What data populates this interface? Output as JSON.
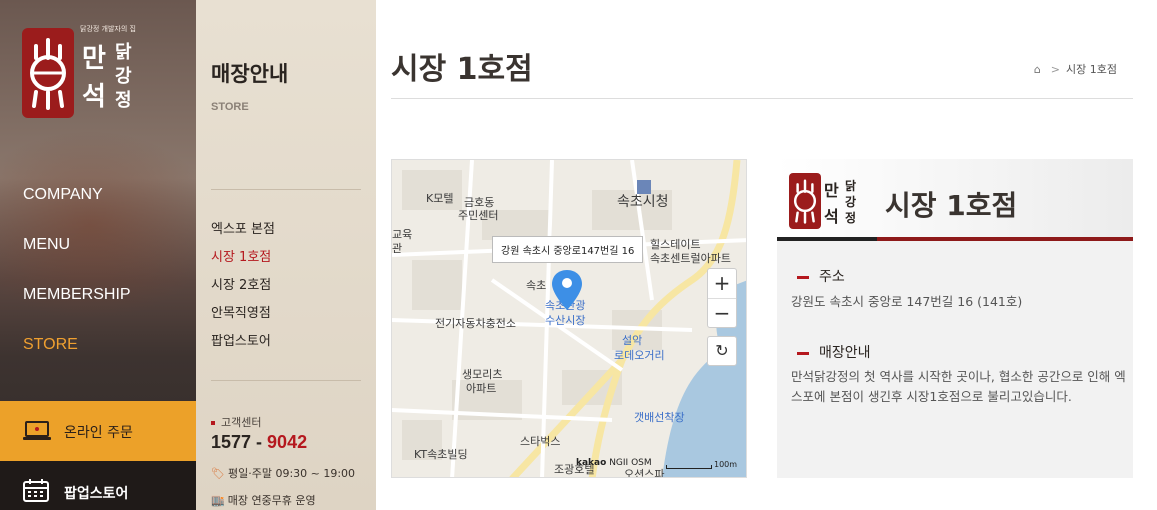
{
  "brand": {
    "tagline": "닭강정 개발자의 집",
    "chars": [
      "만",
      "닭",
      "강",
      "정",
      "석"
    ]
  },
  "nav": {
    "items": [
      "COMPANY",
      "MENU",
      "MEMBERSHIP",
      "STORE"
    ],
    "active": "STORE"
  },
  "actions": {
    "online_order": "온라인 주문",
    "popup_store": "팝업스토어"
  },
  "sub": {
    "title": "매장안내",
    "subtitle": "STORE",
    "items": [
      "엑스포 본점",
      "시장 1호점",
      "시장 2호점",
      "안목직영점",
      "팝업스토어"
    ],
    "active": "시장 1호점"
  },
  "customer": {
    "label": "고객센터",
    "phone_a": "1577",
    "phone_sep": " - ",
    "phone_b": "9042",
    "hours": "평일·주말 09:30 ~ 19:00",
    "holiday": "매장 연중무휴 운영"
  },
  "page": {
    "title": "시장 1호점",
    "breadcrumb": "시장 1호점"
  },
  "map": {
    "address_popup": "강원 속초시 중앙로147번길 16",
    "labels": {
      "kmotel": "K모텔",
      "geumho1": "금호동",
      "geumho2": "주민센터",
      "sokcho_city": "속초시청",
      "edu1": "교육",
      "edu2": "관",
      "hills1": "힐스테이트",
      "hills2": "속초센트럴아파트",
      "market_a": "속초",
      "market_b": "속초관광",
      "market_c": "수산시장",
      "ev": "전기자동차충전소",
      "seorak1": "설악",
      "seorak2": "로데오거리",
      "semoris1": "생모리츠",
      "semoris2": "아파트",
      "gaetbae": "갯배선착장",
      "starbucks": "스타벅스",
      "kt": "KT속초빌딩",
      "jokwang": "조광호텔",
      "bottom": "오션스파"
    },
    "zoom_in": "+",
    "zoom_out": "−",
    "reset": "↻",
    "credit_brand": "kakao",
    "credit_osm": "NGII OSM",
    "scale": "100m"
  },
  "info": {
    "title": "시장 1호점",
    "address_heading": "주소",
    "address": "강원도 속초시 중앙로 147번길 16 (141호)",
    "store_heading": "매장안내",
    "store_text": "만석닭강정의 첫 역사를 시작한 곳이나, 협소한 공간으로 인해 엑스포에 본점이 생긴후 시장1호점으로 불리고있습니다."
  }
}
